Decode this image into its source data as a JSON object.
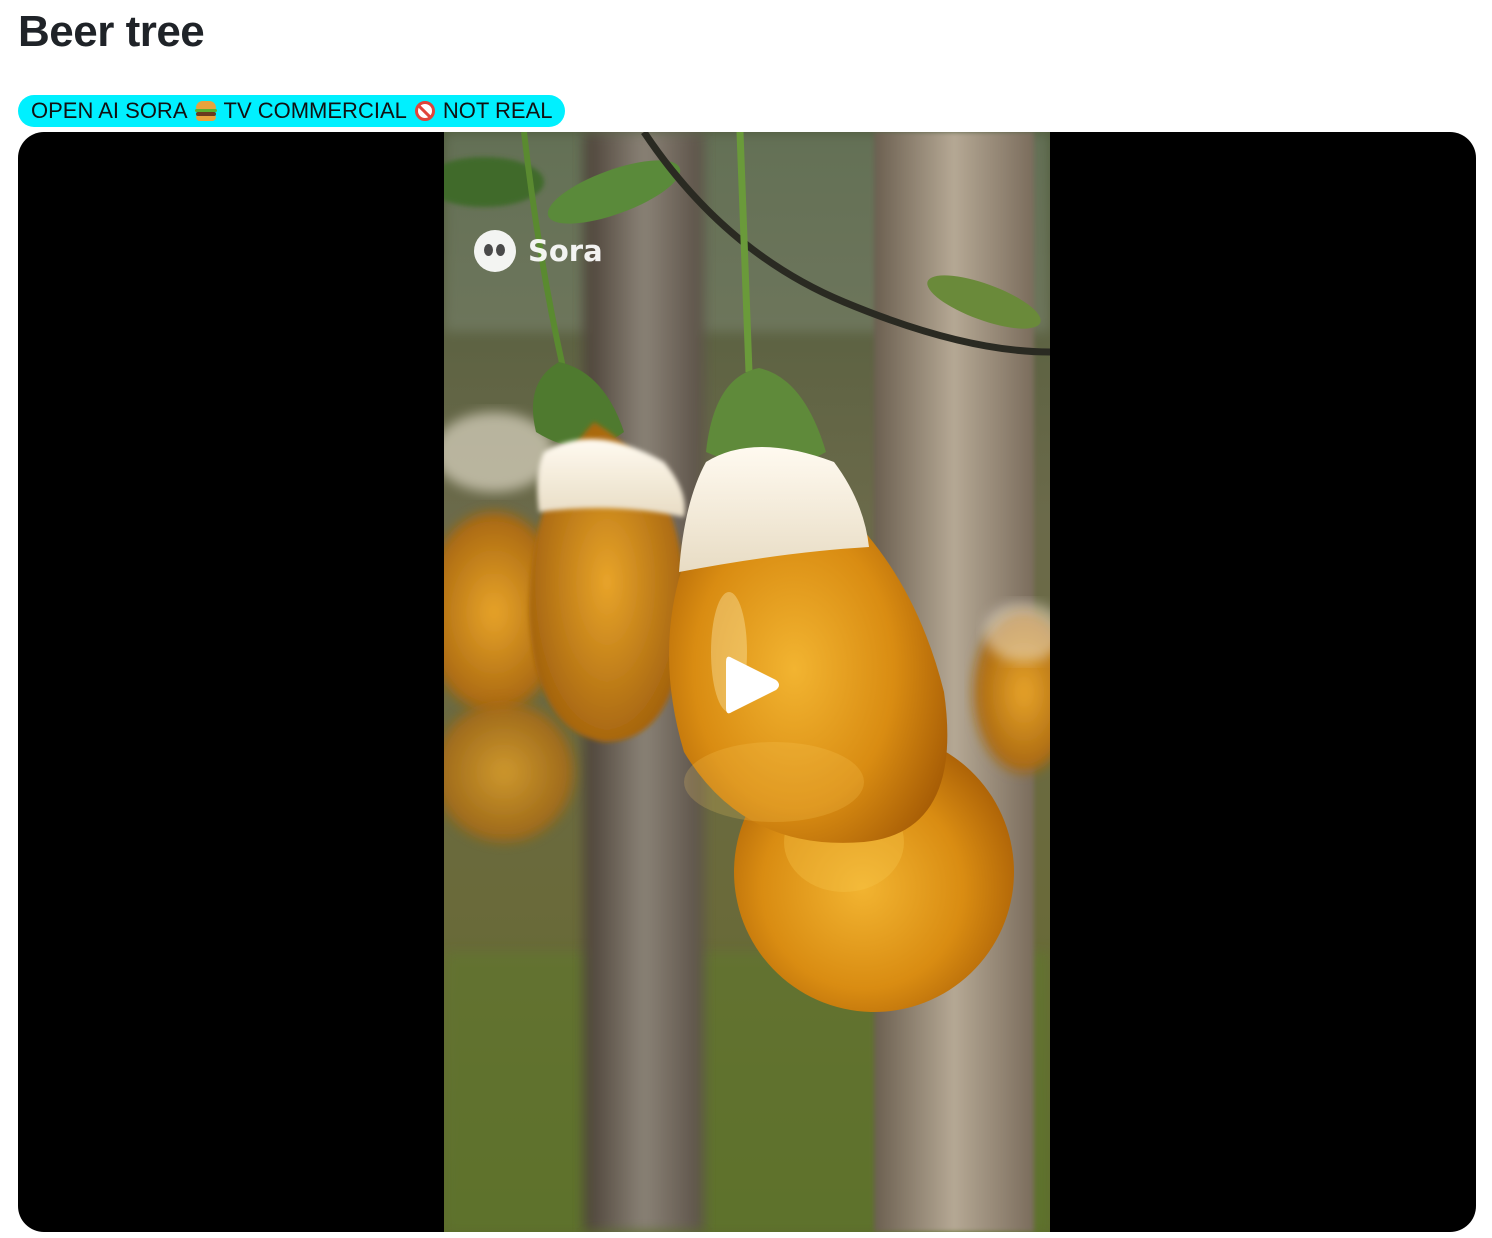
{
  "post": {
    "title": "Beer tree",
    "tag": {
      "text_part1": "OPEN AI SORA",
      "emoji1": "hamburger-emoji",
      "text_part2": "TV COMMERCIAL",
      "emoji2": "no-entry-emoji",
      "text_part3": "NOT REAL",
      "color": "#00f0ff"
    }
  },
  "video": {
    "watermark": "Sora",
    "play_icon": "play-icon",
    "background": "#000000"
  }
}
